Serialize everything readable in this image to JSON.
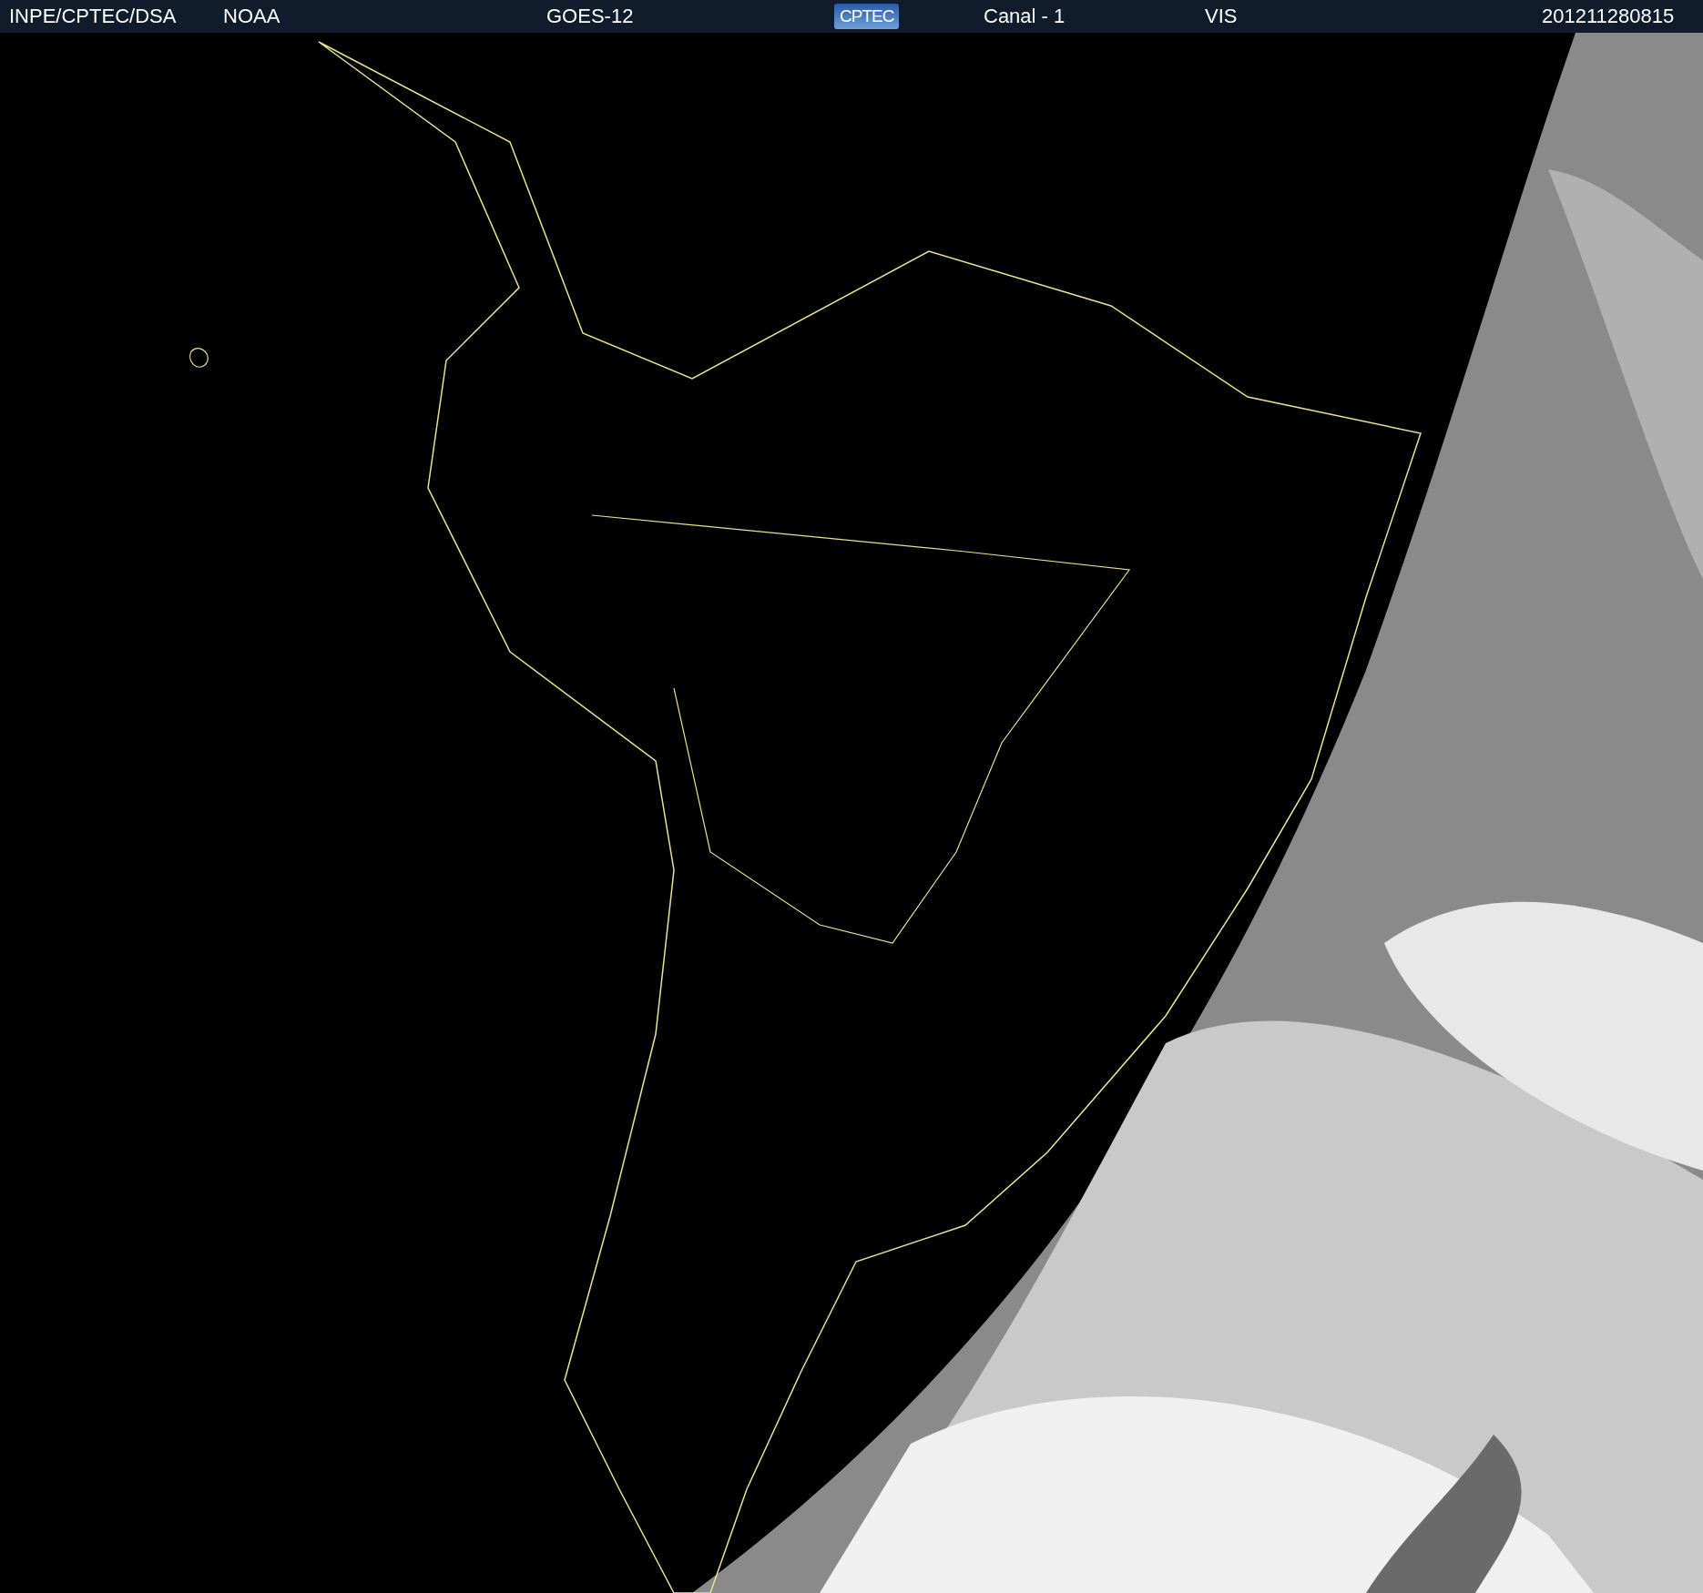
{
  "header": [
    {
      "kind": "text",
      "text": "INPE/CPTEC/DSA"
    },
    {
      "kind": "text",
      "text": "NOAA"
    },
    {
      "kind": "text",
      "text": "GOES-12"
    },
    {
      "kind": "logo",
      "text": "CPTEC"
    },
    {
      "kind": "text",
      "text": "Canal - 1"
    },
    {
      "kind": "text",
      "text": "VIS"
    },
    {
      "kind": "text",
      "text": "201211280815"
    }
  ]
}
